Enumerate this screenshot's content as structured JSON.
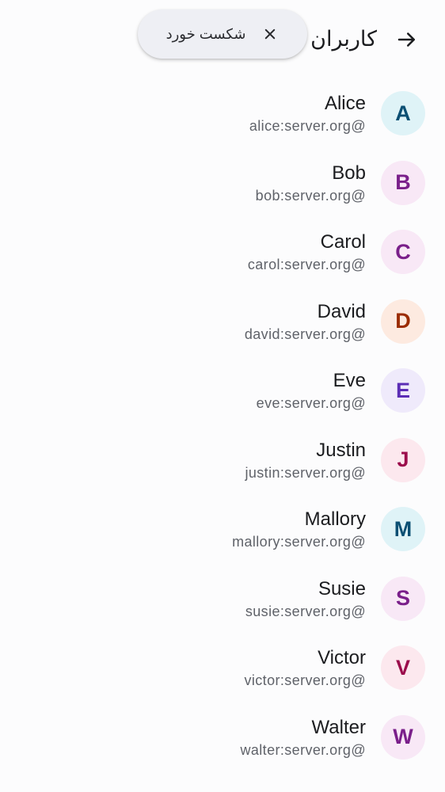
{
  "header": {
    "title": "کاربران",
    "back_icon": "arrow-right-icon"
  },
  "chip": {
    "label": "شکست خورد",
    "close_icon": "close-icon"
  },
  "users": [
    {
      "initial": "A",
      "name": "Alice",
      "id": "alice:server.org@",
      "bg": "#dff3f7",
      "fg": "#0b4f73"
    },
    {
      "initial": "B",
      "name": "Bob",
      "id": "bob:server.org@",
      "bg": "#f8e8f6",
      "fg": "#7a1f8a"
    },
    {
      "initial": "C",
      "name": "Carol",
      "id": "carol:server.org@",
      "bg": "#f8e8f6",
      "fg": "#7a1f8a"
    },
    {
      "initial": "D",
      "name": "David",
      "id": "david:server.org@",
      "bg": "#fdeae0",
      "fg": "#9b2c00"
    },
    {
      "initial": "E",
      "name": "Eve",
      "id": "eve:server.org@",
      "bg": "#efeafb",
      "fg": "#5b2db5"
    },
    {
      "initial": "J",
      "name": "Justin",
      "id": "justin:server.org@",
      "bg": "#fce8ee",
      "fg": "#9b0d4c"
    },
    {
      "initial": "M",
      "name": "Mallory",
      "id": "mallory:server.org@",
      "bg": "#dff3f7",
      "fg": "#0b4f73"
    },
    {
      "initial": "S",
      "name": "Susie",
      "id": "susie:server.org@",
      "bg": "#f8e8f6",
      "fg": "#7a1f8a"
    },
    {
      "initial": "V",
      "name": "Victor",
      "id": "victor:server.org@",
      "bg": "#fce8ee",
      "fg": "#9b0d4c"
    },
    {
      "initial": "W",
      "name": "Walter",
      "id": "walter:server.org@",
      "bg": "#f8e8f6",
      "fg": "#7a1f8a"
    }
  ]
}
